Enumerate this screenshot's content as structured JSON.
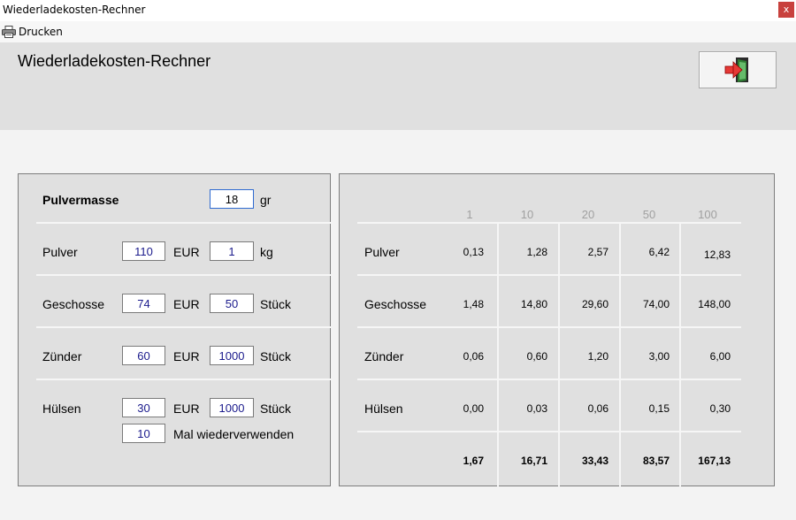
{
  "window": {
    "title": "Wiederladekosten-Rechner",
    "close_label": "x"
  },
  "menu": {
    "print_label": "Drucken"
  },
  "header": {
    "title": "Wiederladekosten-Rechner"
  },
  "inputs": {
    "pulvermasse": {
      "label": "Pulvermasse",
      "value": "18",
      "unit": "gr"
    },
    "pulver": {
      "label": "Pulver",
      "price": "110",
      "currency": "EUR",
      "qty": "1",
      "unit": "kg"
    },
    "geschosse": {
      "label": "Geschosse",
      "price": "74",
      "currency": "EUR",
      "qty": "50",
      "unit": "Stück"
    },
    "zuender": {
      "label": "Zünder",
      "price": "60",
      "currency": "EUR",
      "qty": "1000",
      "unit": "Stück"
    },
    "huelsen": {
      "label": "Hülsen",
      "price": "30",
      "currency": "EUR",
      "qty": "1000",
      "unit": "Stück",
      "reuse": "10",
      "reuse_label": "Mal wiederverwenden"
    }
  },
  "table": {
    "columns": [
      "1",
      "10",
      "20",
      "50",
      "100"
    ],
    "rows": [
      {
        "label": "Pulver",
        "values": [
          "0,13",
          "1,28",
          "2,57",
          "6,42",
          "12,83"
        ]
      },
      {
        "label": "Geschosse",
        "values": [
          "1,48",
          "14,80",
          "29,60",
          "74,00",
          "148,00"
        ]
      },
      {
        "label": "Zünder",
        "values": [
          "0,06",
          "0,60",
          "1,20",
          "3,00",
          "6,00"
        ]
      },
      {
        "label": "Hülsen",
        "values": [
          "0,00",
          "0,03",
          "0,06",
          "0,15",
          "0,30"
        ]
      }
    ],
    "totals": [
      "1,67",
      "16,71",
      "33,43",
      "83,57",
      "167,13"
    ]
  }
}
